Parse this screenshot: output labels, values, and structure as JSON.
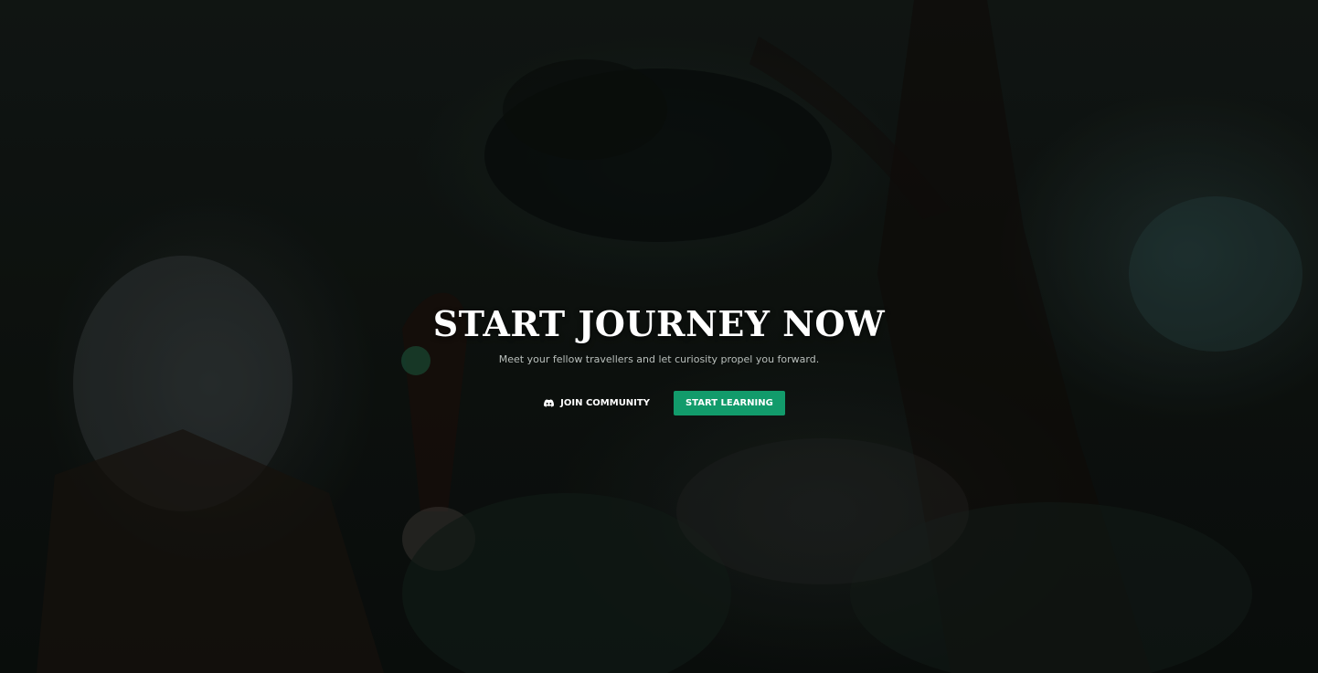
{
  "hero": {
    "title": "START JOURNEY NOW",
    "subtitle": "Meet your fellow travellers and let curiosity propel you forward.",
    "join_community_label": "JOIN COMMUNITY",
    "start_learning_label": "START LEARNING",
    "join_community_icon": "discord-icon"
  },
  "colors": {
    "primary_button": "#129b6b",
    "title_text": "#ffffff",
    "subtitle_text": "#b9bfbc"
  }
}
